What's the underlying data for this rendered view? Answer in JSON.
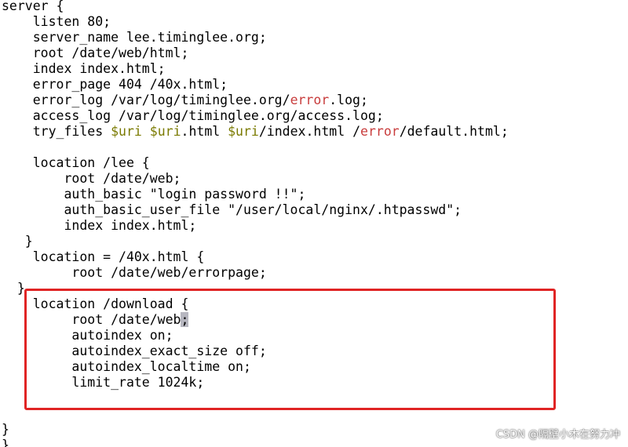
{
  "editor": {
    "lines": [
      [
        {
          "t": "server {"
        }
      ],
      [
        {
          "t": "    listen 80;"
        }
      ],
      [
        {
          "t": "    server_name lee.timinglee.org;"
        }
      ],
      [
        {
          "t": "    root /date/web/html;"
        }
      ],
      [
        {
          "t": "    index index.html;"
        }
      ],
      [
        {
          "t": "    error_page 404 /40x.html;"
        }
      ],
      [
        {
          "t": "    error_log /var/log/timinglee.org/"
        },
        {
          "t": "error",
          "c": "red"
        },
        {
          "t": ".log;"
        }
      ],
      [
        {
          "t": "    access_log /var/log/timinglee.org/access.log;"
        }
      ],
      [
        {
          "t": "    try_files "
        },
        {
          "t": "$uri",
          "c": "olive"
        },
        {
          "t": " "
        },
        {
          "t": "$uri",
          "c": "olive"
        },
        {
          "t": ".html "
        },
        {
          "t": "$uri",
          "c": "olive"
        },
        {
          "t": "/index.html /"
        },
        {
          "t": "error",
          "c": "red"
        },
        {
          "t": "/default.html;"
        }
      ],
      [
        {
          "t": ""
        }
      ],
      [
        {
          "t": "    location /lee {"
        }
      ],
      [
        {
          "t": "        root /date/web;"
        }
      ],
      [
        {
          "t": "        auth_basic \"login password !!\";"
        }
      ],
      [
        {
          "t": "        auth_basic_user_file \"/user/local/nginx/.htpasswd\";"
        }
      ],
      [
        {
          "t": "        index index.html;"
        }
      ],
      [
        {
          "t": "   }"
        }
      ],
      [
        {
          "t": "    location = /40x.html {"
        }
      ],
      [
        {
          "t": "         root /date/web/errorpage;"
        }
      ],
      [
        {
          "t": "  }"
        }
      ],
      [
        {
          "t": "    location /download {"
        }
      ],
      [
        {
          "t": "         root /date/web"
        },
        {
          "t": ";",
          "c": "cursor"
        }
      ],
      [
        {
          "t": "         autoindex on;"
        }
      ],
      [
        {
          "t": "         autoindex_exact_size off;"
        }
      ],
      [
        {
          "t": "         autoindex_localtime on;"
        }
      ],
      [
        {
          "t": "         limit_rate 1024k;"
        }
      ],
      [
        {
          "t": ""
        }
      ],
      [
        {
          "t": ""
        }
      ],
      [
        {
          "t": "}"
        }
      ],
      [
        {
          "t": "}"
        }
      ]
    ]
  },
  "watermark": "CSDN @隔壁小木在努力冲",
  "colors": {
    "keyword_error": "#c83c3c",
    "variable": "#7a7a00",
    "highlight_box": "#e02424",
    "cursor": "#b7b7c0"
  }
}
